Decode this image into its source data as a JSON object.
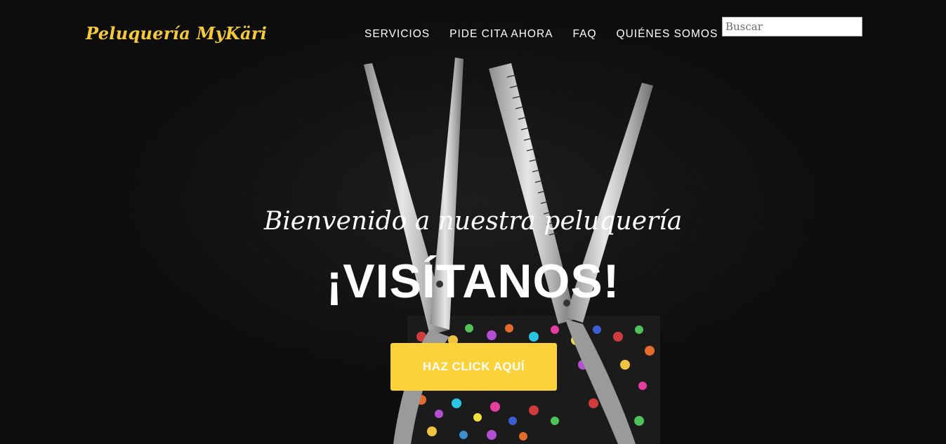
{
  "brand": {
    "logo_text": "Peluquería MyKäri",
    "accent_color": "#f5c93a"
  },
  "nav": {
    "items": [
      {
        "label": "SERVICIOS"
      },
      {
        "label": "PIDE CITA AHORA"
      },
      {
        "label": "FAQ"
      },
      {
        "label": "QUIÉNES SOMOS"
      }
    ]
  },
  "search": {
    "placeholder": "Buscar",
    "value": ""
  },
  "hero": {
    "subtitle": "Bienvenido a nuestra peluquería",
    "title": "¡VISÍTANOS!",
    "cta_label": "HAZ CLICK AQUÍ",
    "cta_color": "#fcd23b",
    "background_image": "scissors-in-jeweled-holder-image"
  }
}
